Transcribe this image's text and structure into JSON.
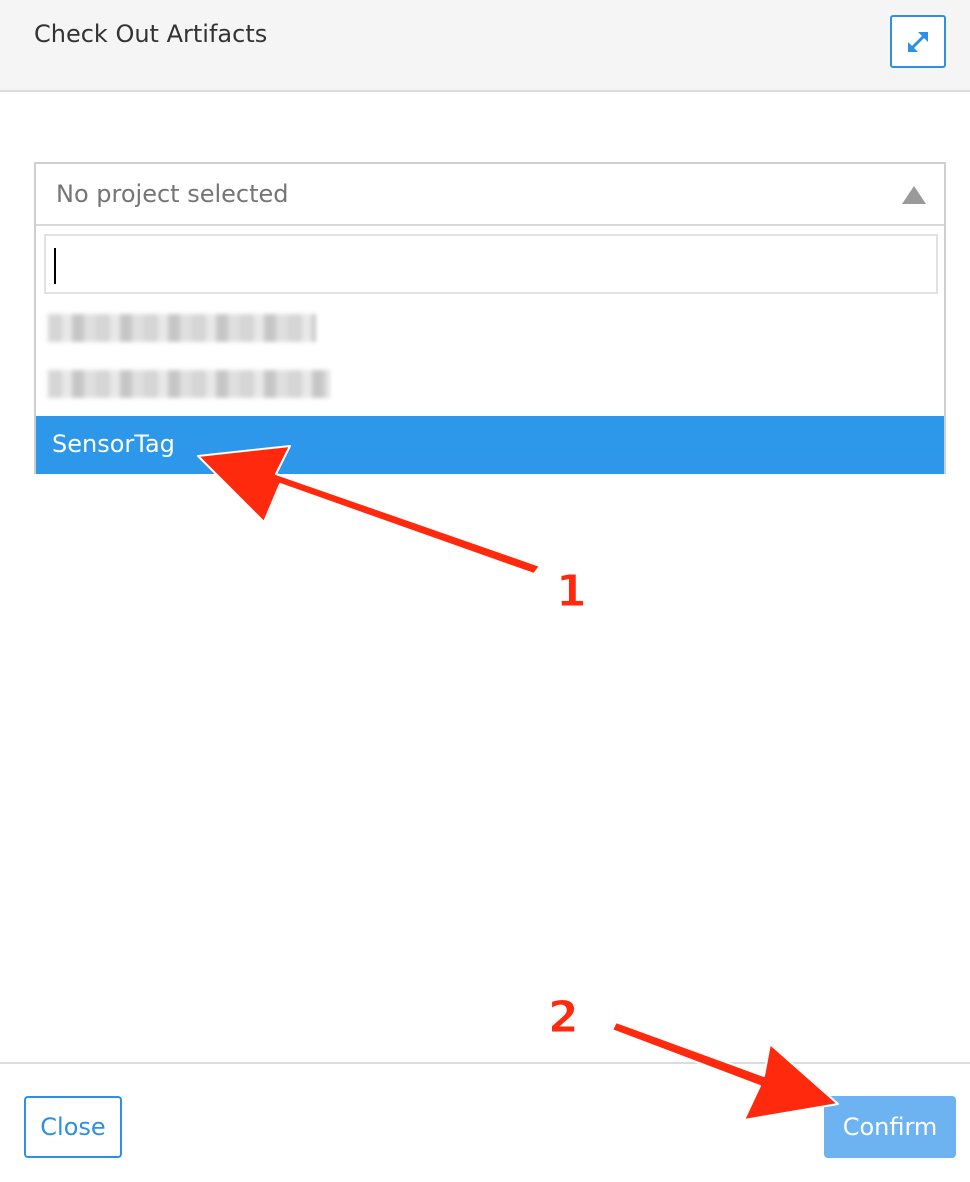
{
  "dialog": {
    "title": "Check Out Artifacts",
    "expand_icon": "expand-arrows-icon"
  },
  "project_select": {
    "placeholder": "No project selected",
    "caret_icon": "caret-up-icon",
    "search_value": "",
    "options": [
      {
        "label": "",
        "state": "blurred"
      },
      {
        "label": "",
        "state": "blurred"
      },
      {
        "label": "SensorTag",
        "state": "selected"
      }
    ]
  },
  "footer": {
    "close_label": "Close",
    "confirm_label": "Confirm"
  },
  "annotations": {
    "step1": "1",
    "step2": "2",
    "arrow_color": "#ff2a0e"
  },
  "colors": {
    "accent": "#2d8fe6",
    "selected_option": "#2d97ea",
    "confirm_bg": "#6db3f2"
  }
}
